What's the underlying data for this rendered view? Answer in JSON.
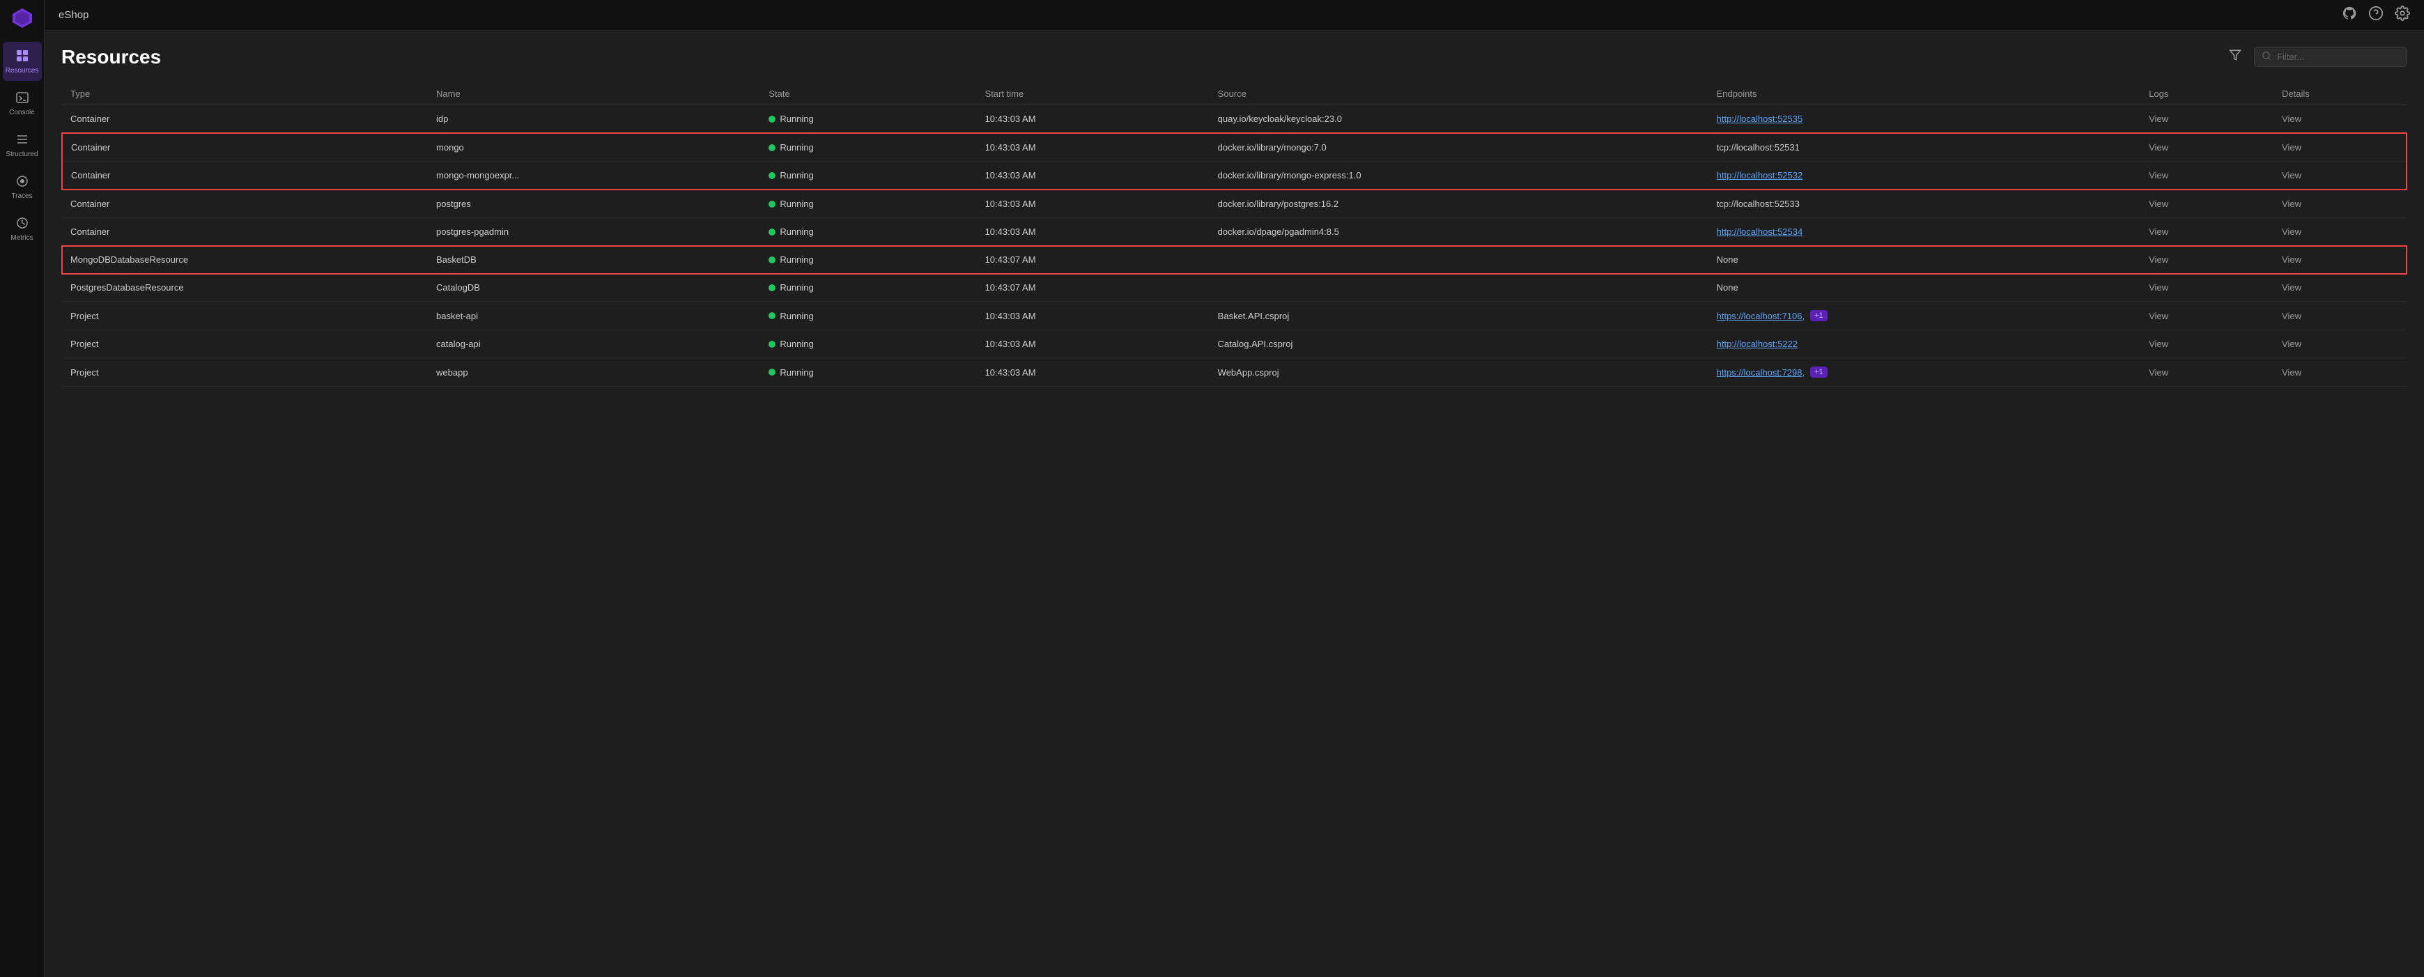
{
  "app": {
    "name": "eShop"
  },
  "sidebar": {
    "items": [
      {
        "id": "resources",
        "label": "Resources",
        "active": true,
        "icon": "⊞"
      },
      {
        "id": "console",
        "label": "Console",
        "active": false,
        "icon": "⬜"
      },
      {
        "id": "structured",
        "label": "Structured",
        "active": false,
        "icon": "☰"
      },
      {
        "id": "traces",
        "label": "Traces",
        "active": false,
        "icon": "◈"
      },
      {
        "id": "metrics",
        "label": "Metrics",
        "active": false,
        "icon": "◉"
      }
    ]
  },
  "header": {
    "title": "Resources",
    "filter_placeholder": "Filter...",
    "filter_icon": "⊟",
    "search_icon": "🔍"
  },
  "topbar": {
    "app_name": "eShop",
    "github_icon": "github",
    "help_icon": "?",
    "settings_icon": "⚙"
  },
  "table": {
    "columns": [
      "Type",
      "Name",
      "State",
      "Start time",
      "Source",
      "Endpoints",
      "Logs",
      "Details"
    ],
    "rows": [
      {
        "type": "Container",
        "name": "idp",
        "state": "Running",
        "start_time": "10:43:03 AM",
        "source": "quay.io/keycloak/keycloak:23.0",
        "endpoint_text": "http://localhost:52535",
        "endpoint_link": true,
        "endpoint_badge": null,
        "logs": "View",
        "details": "View",
        "highlight": "none"
      },
      {
        "type": "Container",
        "name": "mongo",
        "state": "Running",
        "start_time": "10:43:03 AM",
        "source": "docker.io/library/mongo:7.0",
        "endpoint_text": "tcp://localhost:52531",
        "endpoint_link": false,
        "endpoint_badge": null,
        "logs": "View",
        "details": "View",
        "highlight": "group-top"
      },
      {
        "type": "Container",
        "name": "mongo-mongoexpr...",
        "state": "Running",
        "start_time": "10:43:03 AM",
        "source": "docker.io/library/mongo-express:1.0",
        "endpoint_text": "http://localhost:52532",
        "endpoint_link": true,
        "endpoint_badge": null,
        "logs": "View",
        "details": "View",
        "highlight": "group-bottom"
      },
      {
        "type": "Container",
        "name": "postgres",
        "state": "Running",
        "start_time": "10:43:03 AM",
        "source": "docker.io/library/postgres:16.2",
        "endpoint_text": "tcp://localhost:52533",
        "endpoint_link": false,
        "endpoint_badge": null,
        "logs": "View",
        "details": "View",
        "highlight": "none"
      },
      {
        "type": "Container",
        "name": "postgres-pgadmin",
        "state": "Running",
        "start_time": "10:43:03 AM",
        "source": "docker.io/dpage/pgadmin4:8.5",
        "endpoint_text": "http://localhost:52534",
        "endpoint_link": true,
        "endpoint_badge": null,
        "logs": "View",
        "details": "View",
        "highlight": "none"
      },
      {
        "type": "MongoDBDatabaseResource",
        "name": "BasketDB",
        "state": "Running",
        "start_time": "10:43:07 AM",
        "source": "",
        "endpoint_text": "None",
        "endpoint_link": false,
        "endpoint_badge": null,
        "logs": "View",
        "details": "View",
        "highlight": "single"
      },
      {
        "type": "PostgresDatabaseResource",
        "name": "CatalogDB",
        "state": "Running",
        "start_time": "10:43:07 AM",
        "source": "",
        "endpoint_text": "None",
        "endpoint_link": false,
        "endpoint_badge": null,
        "logs": "View",
        "details": "View",
        "highlight": "none"
      },
      {
        "type": "Project",
        "name": "basket-api",
        "state": "Running",
        "start_time": "10:43:03 AM",
        "source": "Basket.API.csproj",
        "endpoint_text": "https://localhost:7106,",
        "endpoint_link": true,
        "endpoint_badge": "+1",
        "logs": "View",
        "details": "View",
        "highlight": "none"
      },
      {
        "type": "Project",
        "name": "catalog-api",
        "state": "Running",
        "start_time": "10:43:03 AM",
        "source": "Catalog.API.csproj",
        "endpoint_text": "http://localhost:5222",
        "endpoint_link": true,
        "endpoint_badge": null,
        "logs": "View",
        "details": "View",
        "highlight": "none"
      },
      {
        "type": "Project",
        "name": "webapp",
        "state": "Running",
        "start_time": "10:43:03 AM",
        "source": "WebApp.csproj",
        "endpoint_text": "https://localhost:7298,",
        "endpoint_link": true,
        "endpoint_badge": "+1",
        "logs": "View",
        "details": "View",
        "highlight": "none"
      }
    ]
  }
}
